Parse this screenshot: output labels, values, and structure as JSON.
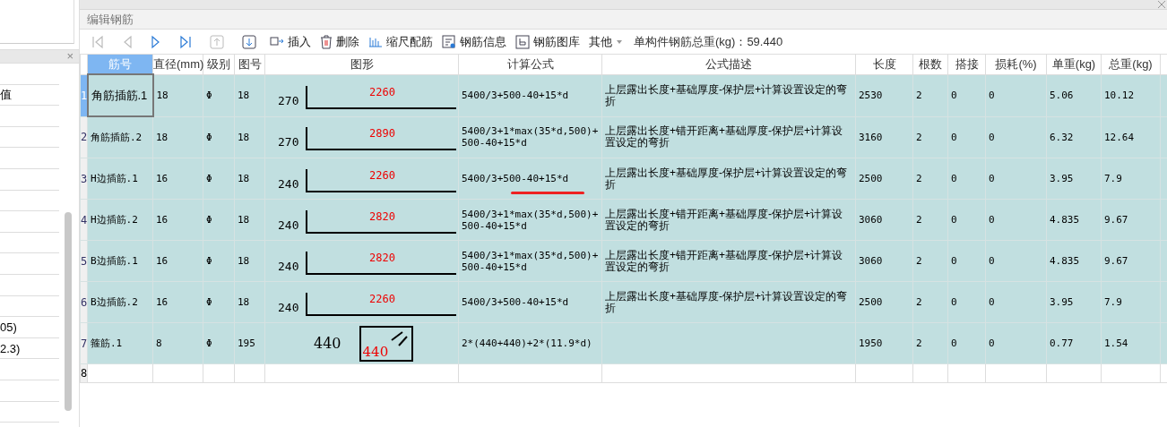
{
  "left_panel": {
    "close": "×",
    "cells": [
      "",
      "值",
      "",
      "",
      "",
      "",
      "",
      "",
      "",
      "",
      "",
      "",
      "05)",
      "2.3)",
      "",
      "",
      ""
    ]
  },
  "window": {
    "title": "编辑钢筋"
  },
  "toolbar": {
    "buttons": [
      {
        "kind": "first",
        "disabled": true
      },
      {
        "kind": "prev",
        "disabled": true
      },
      {
        "kind": "next",
        "disabled": false
      },
      {
        "kind": "last",
        "disabled": false
      },
      {
        "kind": "up",
        "disabled": true
      },
      {
        "kind": "down",
        "disabled": false
      },
      {
        "kind": "insert",
        "label": "插入"
      },
      {
        "kind": "delete",
        "label": "删除"
      },
      {
        "kind": "scale",
        "label": "缩尺配筋"
      },
      {
        "kind": "info",
        "label": "钢筋信息"
      },
      {
        "kind": "library",
        "label": "钢筋图库"
      },
      {
        "kind": "dropdown",
        "label": "其他"
      }
    ],
    "total": "单构件钢筋总重(kg)：59.440"
  },
  "table": {
    "columns": [
      "筋号",
      "直径(mm)",
      "级别",
      "图号",
      "图形",
      "计算公式",
      "公式描述",
      "长度",
      "根数",
      "搭接",
      "损耗(%)",
      "单重(kg)",
      "总重(kg)"
    ],
    "rows": [
      {
        "num": "1",
        "selected": true,
        "name": "角筋插筋.1",
        "dia": "18",
        "grade": "Φ",
        "fig": "18",
        "shape": {
          "kind": "bar",
          "hook": "270",
          "length": "2260"
        },
        "formula": "5400/3+500-40+15*d",
        "marked": false,
        "desc": "上层露出长度+基础厚度-保护层+计算设置设定的弯折",
        "len": "2530",
        "count": "2",
        "lap": "0",
        "loss": "0",
        "unit": "5.06",
        "total": "10.12"
      },
      {
        "num": "2",
        "selected": false,
        "name": "角筋插筋.2",
        "dia": "18",
        "grade": "Φ",
        "fig": "18",
        "shape": {
          "kind": "bar",
          "hook": "270",
          "length": "2890"
        },
        "formula": "5400/3+1*max(35*d,500)+500-40+15*d",
        "marked": false,
        "desc": "上层露出长度+错开距离+基础厚度-保护层+计算设置设定的弯折",
        "len": "3160",
        "count": "2",
        "lap": "0",
        "loss": "0",
        "unit": "6.32",
        "total": "12.64"
      },
      {
        "num": "3",
        "selected": false,
        "name": "H边插筋.1",
        "dia": "16",
        "grade": "Φ",
        "fig": "18",
        "shape": {
          "kind": "bar",
          "hook": "240",
          "length": "2260"
        },
        "formula": "5400/3+500-40+15*d",
        "marked": true,
        "desc": "上层露出长度+基础厚度-保护层+计算设置设定的弯折",
        "len": "2500",
        "count": "2",
        "lap": "0",
        "loss": "0",
        "unit": "3.95",
        "total": "7.9"
      },
      {
        "num": "4",
        "selected": false,
        "name": "H边插筋.2",
        "dia": "16",
        "grade": "Φ",
        "fig": "18",
        "shape": {
          "kind": "bar",
          "hook": "240",
          "length": "2820"
        },
        "formula": "5400/3+1*max(35*d,500)+500-40+15*d",
        "marked": false,
        "desc": "上层露出长度+错开距离+基础厚度-保护层+计算设置设定的弯折",
        "len": "3060",
        "count": "2",
        "lap": "0",
        "loss": "0",
        "unit": "4.835",
        "total": "9.67"
      },
      {
        "num": "5",
        "selected": false,
        "name": "B边插筋.1",
        "dia": "16",
        "grade": "Φ",
        "fig": "18",
        "shape": {
          "kind": "bar",
          "hook": "240",
          "length": "2820"
        },
        "formula": "5400/3+1*max(35*d,500)+500-40+15*d",
        "marked": false,
        "desc": "上层露出长度+错开距离+基础厚度-保护层+计算设置设定的弯折",
        "len": "3060",
        "count": "2",
        "lap": "0",
        "loss": "0",
        "unit": "4.835",
        "total": "9.67"
      },
      {
        "num": "6",
        "selected": false,
        "name": "B边插筋.2",
        "dia": "16",
        "grade": "Φ",
        "fig": "18",
        "shape": {
          "kind": "bar",
          "hook": "240",
          "length": "2260"
        },
        "formula": "5400/3+500-40+15*d",
        "marked": false,
        "desc": "上层露出长度+基础厚度-保护层+计算设置设定的弯折",
        "len": "2500",
        "count": "2",
        "lap": "0",
        "loss": "0",
        "unit": "3.95",
        "total": "7.9"
      },
      {
        "num": "7",
        "selected": false,
        "name": "箍筋.1",
        "dia": "8",
        "grade": "Φ",
        "fig": "195",
        "shape": {
          "kind": "stirrup",
          "hook": "440",
          "length": "440"
        },
        "formula": "2*(440+440)+2*(11.9*d)",
        "marked": false,
        "desc": "",
        "len": "1950",
        "count": "2",
        "lap": "0",
        "loss": "0",
        "unit": "0.77",
        "total": "1.54"
      }
    ],
    "blank_row": "8"
  }
}
